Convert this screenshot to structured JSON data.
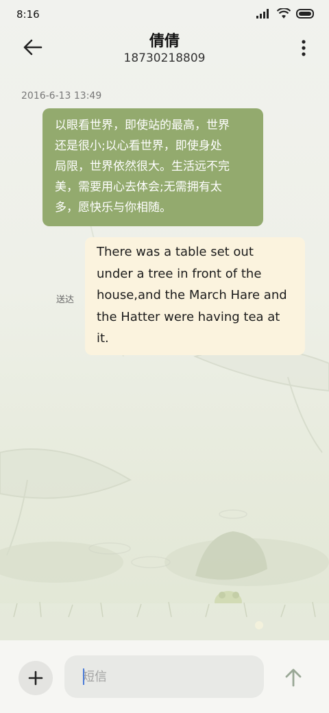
{
  "status_bar": {
    "time": "8:16"
  },
  "header": {
    "contact_name": "倩倩",
    "phone_number": "18730218809"
  },
  "messages": [
    {
      "timestamp": "2016-6-13 13:49",
      "text": "以眼看世界，即使站的最高，世界还是很小;以心看世界，即使身处局限，世界依然很大。生活远不完美，需要用心去体会;无需拥有太多，愿快乐与你相随。",
      "lines": [
        "以眼看世界，即使站的最高，世界",
        "还是很小;以心看世界，即使身处",
        "局限，世界依然很大。生活远不完",
        "美，需要用心去体会;无需拥有太",
        "多，愿快乐与你相随。"
      ]
    },
    {
      "text": "There was a table set out under a tree in front of the house,and the March Hare and the Hatter were having tea at it.",
      "lines": [
        "There was a table set out",
        "under a tree in front of the",
        "house,and the March Hare and",
        "the Hatter were having tea at",
        "it."
      ],
      "status": "送达"
    }
  ],
  "compose": {
    "placeholder": "短信"
  },
  "colors": {
    "bubble_received": "#93aa6e",
    "bubble_sent": "#fbf3de"
  }
}
